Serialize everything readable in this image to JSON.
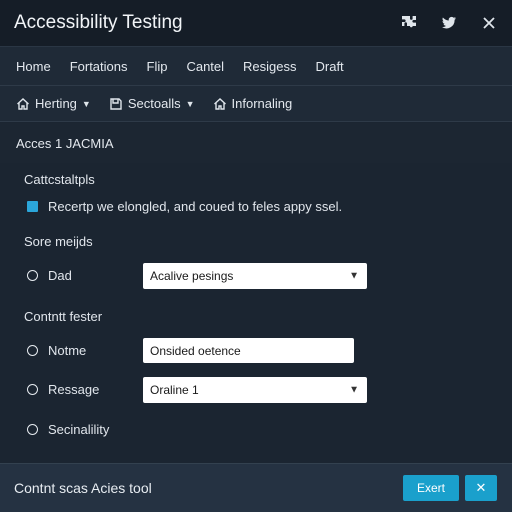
{
  "window": {
    "title": "Accessibility Testing",
    "icons": [
      "puzzle-icon",
      "bird-icon",
      "close-icon"
    ]
  },
  "nav": {
    "items": [
      "Home",
      "Fortations",
      "Flip",
      "Cantel",
      "Resigess",
      "Draft"
    ]
  },
  "toolbar": {
    "items": [
      {
        "label": "Herting",
        "icon": "home-icon",
        "dropdown": true
      },
      {
        "label": "Sectoalls",
        "icon": "bookmark-icon",
        "dropdown": true
      },
      {
        "label": "Infornaling",
        "icon": "home-icon",
        "dropdown": false
      }
    ]
  },
  "section": {
    "title": "Acces 1 JACMIA"
  },
  "form": {
    "group1_label": "Cattcstaltpls",
    "checkbox_label": "Recertp we elongled, and coued to feles appy ssel.",
    "group2_label": "Sore meijds",
    "radio1_label": "Dad",
    "select1_value": "Acalive pesings",
    "group3_label": "Contntt fester",
    "radio2_label": "Notme",
    "textbox_value": "Onsided oetence",
    "radio3_label": "Ressage",
    "select2_value": "Oraline 1",
    "radio4_label": "Secinalility"
  },
  "footer": {
    "text": "Contnt scas Acies tool",
    "primary_button": "Exert",
    "close_button": "✕"
  },
  "colors": {
    "accent": "#1aa0cc",
    "checkbox": "#2ba6da",
    "background": "#1b2531",
    "titlebar": "#151d27"
  }
}
